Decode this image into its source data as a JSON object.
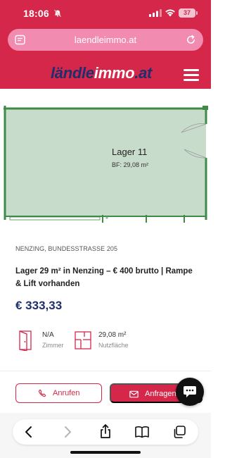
{
  "status_bar": {
    "time": "18:06",
    "battery": "37"
  },
  "browser": {
    "url": "laendleimmo.at"
  },
  "site": {
    "logo_part1": "ländle",
    "logo_part2": "immo",
    "logo_part3": ".at"
  },
  "floorplan": {
    "room_name": "Lager 11",
    "room_area": "BF: 29,08 m²"
  },
  "listing": {
    "location": "NENZING,  BUNDESSTRASSE 205",
    "title": "Lager 29 m² in Nenzing – € 400 brutto | Rampe & Lift vorhanden",
    "price": "€ 333,33",
    "features": [
      {
        "value": "N/A",
        "label": "Zimmer",
        "icon": "door-icon"
      },
      {
        "value": "29,08 m²",
        "label": "Nutzfläche",
        "icon": "floorplan-icon"
      }
    ]
  },
  "actions": {
    "call_label": "Anrufen",
    "inquire_label": "Anfragen"
  },
  "colors": {
    "brand_red": "#d4274a",
    "brand_navy": "#1e2f6e",
    "room_fill": "#c8dccb",
    "wall_green": "#3f8a46"
  }
}
